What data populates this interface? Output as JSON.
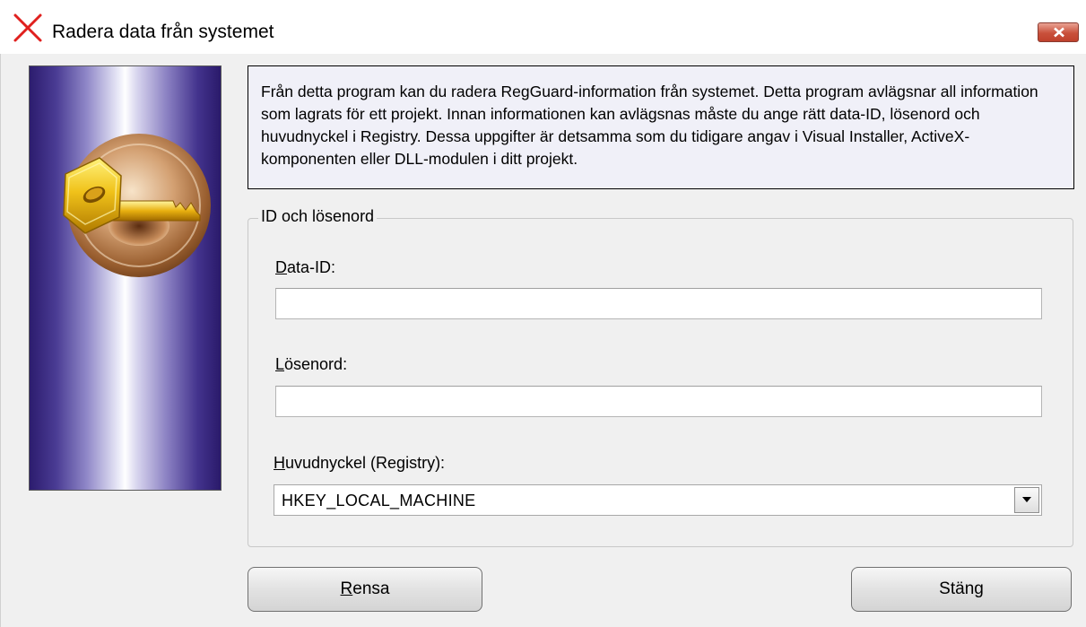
{
  "window": {
    "title": "Radera data från systemet"
  },
  "info": {
    "text": "Från detta program kan du radera RegGuard-information från systemet. Detta program avlägsnar all information som lagrats för ett projekt. Innan informationen kan avlägsnas måste du ange rätt data-ID, lösenord och huvudnyckel i Registry. Dessa uppgifter är detsamma som du tidigare angav i Visual Installer, ActiveX-komponenten eller DLL-modulen i ditt projekt."
  },
  "group": {
    "title": "ID och lösenord",
    "data_id": {
      "label_first": "D",
      "label_rest": "ata-ID:",
      "value": ""
    },
    "password": {
      "label_first": "L",
      "label_rest": "ösenord:",
      "value": ""
    },
    "root_key": {
      "label_first": "H",
      "label_rest": "uvudnyckel (Registry):",
      "selected": "HKEY_LOCAL_MACHINE"
    }
  },
  "buttons": {
    "clear": {
      "first": "R",
      "rest": "ensa"
    },
    "close": "Stäng"
  },
  "icons": {
    "title": "delete-x-icon",
    "titlebar_close": "close-icon",
    "dropdown": "dropdown-arrow-icon",
    "side_image": "key-icon"
  },
  "colors": {
    "close_button": "#c9503b",
    "title_icon": "#e0201e",
    "info_background": "#f0f0f8",
    "side_image_dark": "#2c1c6e"
  }
}
